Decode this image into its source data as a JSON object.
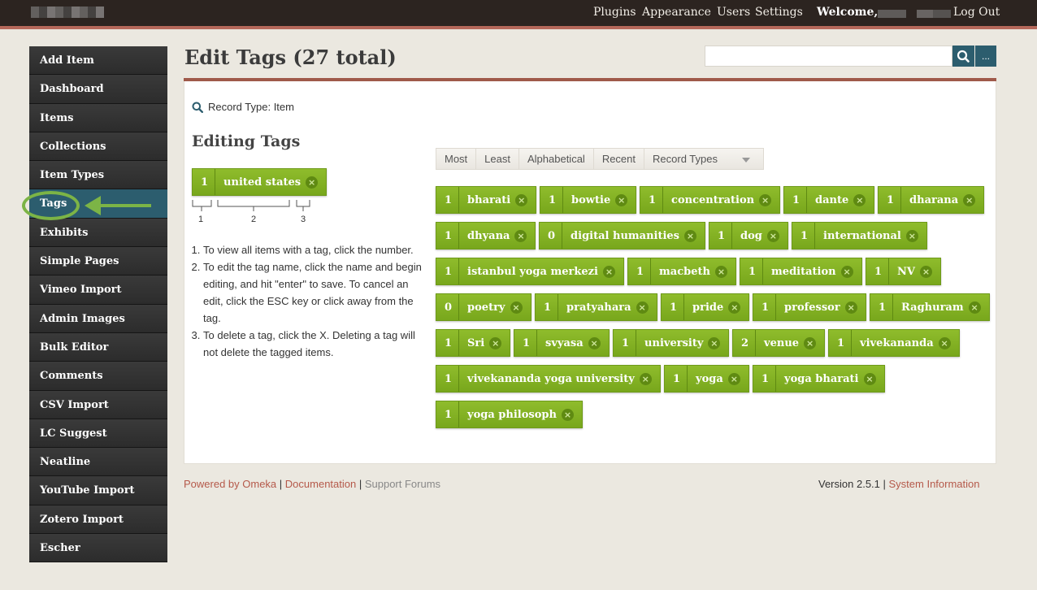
{
  "topbar": {
    "nav": [
      "Plugins",
      "Appearance",
      "Users",
      "Settings"
    ],
    "welcome": "Welcome,",
    "logout": "Log Out"
  },
  "sidebar": {
    "items": [
      "Add Item",
      "Dashboard",
      "Items",
      "Collections",
      "Item Types",
      "Tags",
      "Exhibits",
      "Simple Pages",
      "Vimeo Import",
      "Admin Images",
      "Bulk Editor",
      "Comments",
      "CSV Import",
      "LC Suggest",
      "Neatline",
      "YouTube Import",
      "Zotero Import",
      "Escher"
    ],
    "active": "Tags"
  },
  "header": {
    "title": "Edit Tags (27 total)",
    "search_value": "",
    "advanced_label": "..."
  },
  "main": {
    "record_type": "Record Type: Item",
    "editing_title": "Editing Tags",
    "example_tag": {
      "count": "1",
      "name": "united states"
    },
    "bracket_labels": [
      "1",
      "2",
      "3"
    ],
    "instructions": [
      "To view all items with a tag, click the number.",
      "To edit the tag name, click the name and begin editing, and hit \"enter\" to save. To cancel an edit, click the ESC key or click away from the tag.",
      "To delete a tag, click the X. Deleting a tag will not delete the tagged items."
    ],
    "sort_options": [
      "Most",
      "Least",
      "Alphabetical",
      "Recent",
      "Record Types"
    ],
    "tags": [
      {
        "count": "1",
        "name": "bharati"
      },
      {
        "count": "1",
        "name": "bowtie"
      },
      {
        "count": "1",
        "name": "concentration"
      },
      {
        "count": "1",
        "name": "dante"
      },
      {
        "count": "1",
        "name": "dharana"
      },
      {
        "count": "1",
        "name": "dhyana"
      },
      {
        "count": "0",
        "name": "digital humanities"
      },
      {
        "count": "1",
        "name": "dog"
      },
      {
        "count": "1",
        "name": "international"
      },
      {
        "count": "1",
        "name": "istanbul yoga merkezi"
      },
      {
        "count": "1",
        "name": "macbeth"
      },
      {
        "count": "1",
        "name": "meditation"
      },
      {
        "count": "1",
        "name": "NV"
      },
      {
        "count": "0",
        "name": "poetry"
      },
      {
        "count": "1",
        "name": "pratyahara"
      },
      {
        "count": "1",
        "name": "pride"
      },
      {
        "count": "1",
        "name": "professor"
      },
      {
        "count": "1",
        "name": "Raghuram"
      },
      {
        "count": "1",
        "name": "Sri"
      },
      {
        "count": "1",
        "name": "svyasa"
      },
      {
        "count": "1",
        "name": "university"
      },
      {
        "count": "2",
        "name": "venue"
      },
      {
        "count": "1",
        "name": "vivekananda"
      },
      {
        "count": "1",
        "name": "vivekananda yoga university"
      },
      {
        "count": "1",
        "name": "yoga"
      },
      {
        "count": "1",
        "name": "yoga bharati"
      },
      {
        "count": "1",
        "name": "yoga philosoph"
      }
    ],
    "delete_glyph": "×"
  },
  "footer": {
    "powered": "Powered by Omeka",
    "documentation": "Documentation",
    "support": "Support Forums",
    "version": "Version 2.5.1",
    "system_info": "System Information",
    "separator": " | "
  },
  "colors": {
    "accent": "#2c5d6e",
    "tag_green": "#84b324",
    "rule": "#9f5a4a",
    "link": "#b5594a"
  }
}
